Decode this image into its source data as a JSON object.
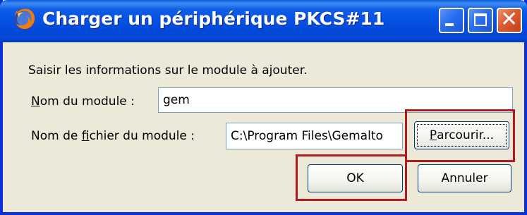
{
  "window": {
    "title": "Charger un périphérique PKCS#11",
    "app_icon": "firefox-icon",
    "controls": {
      "minimize": "minimize-icon",
      "maximize": "maximize-icon",
      "close": "close-icon"
    }
  },
  "dialog": {
    "instruction": "Saisir les informations sur le module à ajouter.",
    "module_name": {
      "label_access_key": "N",
      "label_rest": "om du module :",
      "value": "gem"
    },
    "module_file": {
      "label_before": "Nom de ",
      "label_access_key": "f",
      "label_after": "ichier du module :",
      "value": "C:\\Program Files\\Gemalto"
    },
    "buttons": {
      "browse_access_key": "P",
      "browse_rest": "arcourir...",
      "ok": "OK",
      "cancel": "Annuler"
    }
  },
  "colors": {
    "titlebar": "#0551e3",
    "window_bg": "#ece9d8",
    "highlight_box": "#b01a1a"
  }
}
